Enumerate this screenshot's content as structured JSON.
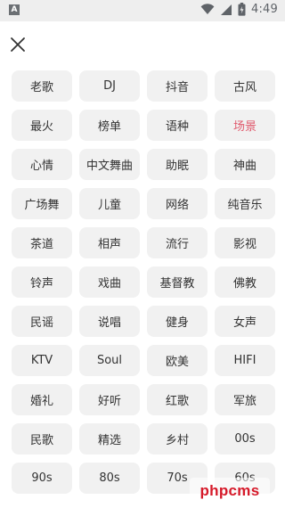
{
  "status_bar": {
    "time": "4:49",
    "left_icon": "A",
    "icons": [
      "wifi-icon",
      "signal-icon",
      "battery-icon"
    ]
  },
  "header": {
    "close_icon": "close-icon"
  },
  "categories": [
    {
      "label": "老歌"
    },
    {
      "label": "DJ"
    },
    {
      "label": "抖音"
    },
    {
      "label": "古风"
    },
    {
      "label": "最火"
    },
    {
      "label": "榜单"
    },
    {
      "label": "语种"
    },
    {
      "label": "场景",
      "active": true
    },
    {
      "label": "心情"
    },
    {
      "label": "中文舞曲"
    },
    {
      "label": "助眠"
    },
    {
      "label": "神曲"
    },
    {
      "label": "广场舞"
    },
    {
      "label": "儿童"
    },
    {
      "label": "网络"
    },
    {
      "label": "纯音乐"
    },
    {
      "label": "茶道"
    },
    {
      "label": "相声"
    },
    {
      "label": "流行"
    },
    {
      "label": "影视"
    },
    {
      "label": "铃声"
    },
    {
      "label": "戏曲"
    },
    {
      "label": "基督教"
    },
    {
      "label": "佛教"
    },
    {
      "label": "民谣"
    },
    {
      "label": "说唱"
    },
    {
      "label": "健身"
    },
    {
      "label": "女声"
    },
    {
      "label": "KTV"
    },
    {
      "label": "Soul"
    },
    {
      "label": "欧美"
    },
    {
      "label": "HIFI"
    },
    {
      "label": "婚礼"
    },
    {
      "label": "好听"
    },
    {
      "label": "红歌"
    },
    {
      "label": "军旅"
    },
    {
      "label": "民歌"
    },
    {
      "label": "精选"
    },
    {
      "label": "乡村"
    },
    {
      "label": "00s"
    },
    {
      "label": "90s"
    },
    {
      "label": "80s"
    },
    {
      "label": "70s"
    },
    {
      "label": "60s"
    }
  ],
  "colors": {
    "active_text": "#e05a6d",
    "chip_background": "#f1f1f1",
    "text": "#333333",
    "watermark": "#d61a2a"
  },
  "watermark": {
    "text": "phpcms"
  }
}
